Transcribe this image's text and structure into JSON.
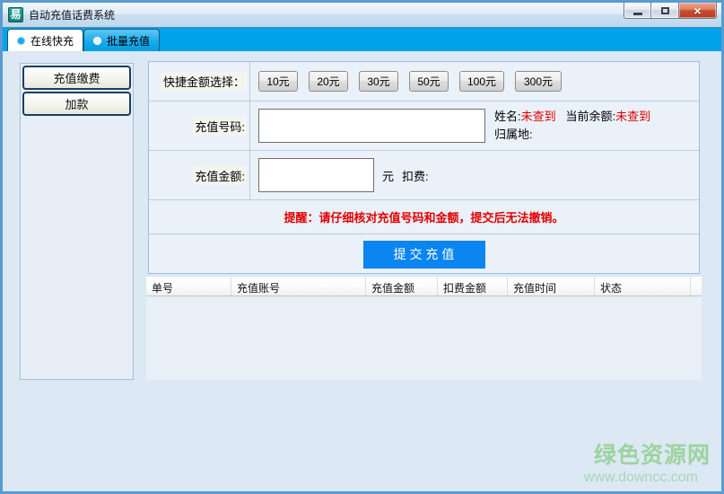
{
  "window": {
    "title": "自动充值话费系统",
    "icon_glyph": "易"
  },
  "tabs": [
    {
      "label": "在线快充",
      "active": true
    },
    {
      "label": "批量充值",
      "active": false
    }
  ],
  "sidebar": {
    "buttons": [
      "充值缴费",
      "加款"
    ]
  },
  "form": {
    "quick_label": "快捷金额选择：",
    "quick_options": [
      "10元",
      "20元",
      "30元",
      "50元",
      "100元",
      "300元"
    ],
    "phone_label": "充值号码:",
    "phone_value": "",
    "name_label": "姓名:",
    "name_value": "未查到",
    "balance_label": "当前余额:",
    "balance_value": "未查到",
    "region_label": "归属地:",
    "amount_label": "充值金额:",
    "amount_value": "",
    "amount_unit": "元",
    "fee_label": "扣费:",
    "reminder": "提醒：请仔细核对充值号码和金额，提交后无法撤销。",
    "submit_label": "提 交 充 值"
  },
  "table": {
    "columns": [
      "单号",
      "充值账号",
      "充值金额",
      "扣费金额",
      "充值时间",
      "状态"
    ],
    "rows": []
  },
  "watermark": {
    "title": "绿色资源网",
    "url": "www.downcc.com"
  },
  "colors": {
    "tab_strip_blue": "#00a2e9",
    "submit_button_blue": "#0b86f0",
    "alert_red": "#e00000",
    "watermark_green": "#9cd39f"
  }
}
